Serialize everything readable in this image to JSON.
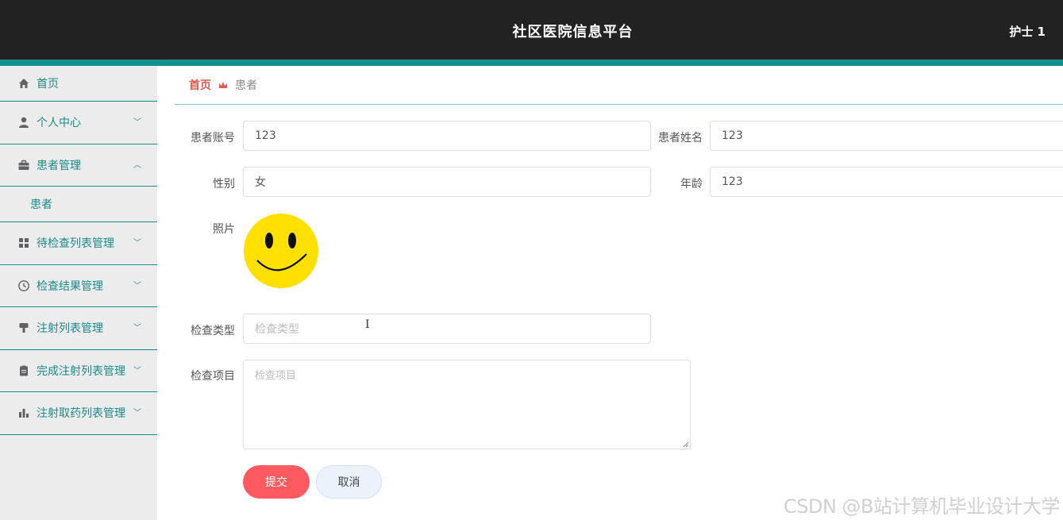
{
  "header": {
    "title": "社区医院信息平台",
    "user": "护士 1"
  },
  "sidebar": {
    "items": [
      {
        "label": "首页"
      },
      {
        "label": "个人中心"
      },
      {
        "label": "患者管理"
      },
      {
        "label": "待检查列表管理"
      },
      {
        "label": "检查结果管理"
      },
      {
        "label": "注射列表管理"
      },
      {
        "label": "完成注射列表管理"
      },
      {
        "label": "注射取药列表管理"
      }
    ],
    "sub_item": "患者"
  },
  "breadcrumb": {
    "home": "首页",
    "current": "患者"
  },
  "form": {
    "account_label": "患者账号",
    "account_value": "123",
    "name_label": "患者姓名",
    "name_value": "123",
    "gender_label": "性别",
    "gender_value": "女",
    "age_label": "年龄",
    "age_value": "123",
    "photo_label": "照片",
    "check_type_label": "检查类型",
    "check_type_placeholder": "检查类型",
    "check_item_label": "检查项目",
    "check_item_placeholder": "检查项目"
  },
  "buttons": {
    "submit": "提交",
    "cancel": "取消"
  },
  "watermark": "CSDN @B站计算机毕业设计大学",
  "colors": {
    "accent": "#138f8e",
    "topbar": "#222222",
    "submit": "#ff5a5f",
    "breadcrumb_home": "#e4574c"
  }
}
